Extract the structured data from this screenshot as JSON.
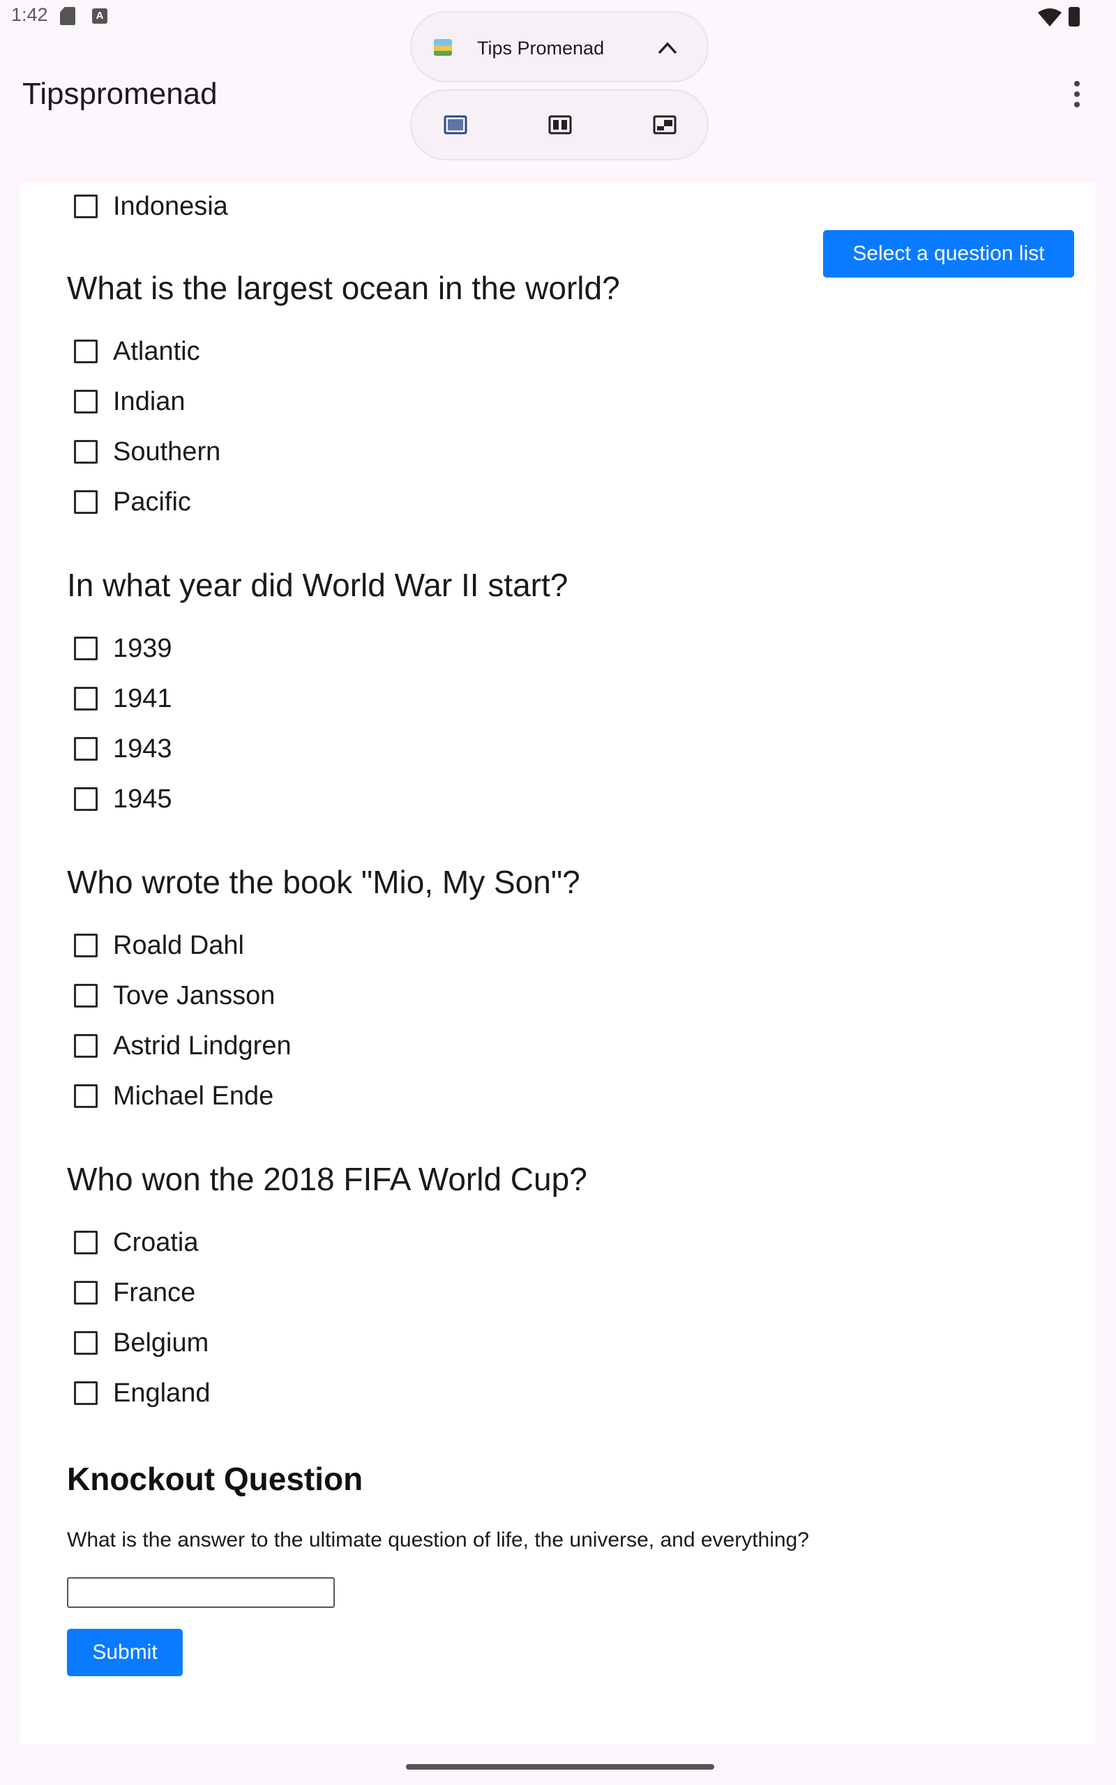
{
  "status_bar": {
    "time": "1:42",
    "a_glyph": "A"
  },
  "app": {
    "title": "Tipspromenad"
  },
  "window_handle": {
    "app_name": "Tips Promenad"
  },
  "actions": {
    "select_question_list": "Select a question list"
  },
  "partial_option": "Indonesia",
  "questions": [
    {
      "text": "What is the largest ocean in the world?",
      "options": [
        "Atlantic",
        "Indian",
        "Southern",
        "Pacific"
      ]
    },
    {
      "text": "In what year did World War II start?",
      "options": [
        "1939",
        "1941",
        "1943",
        "1945"
      ]
    },
    {
      "text": "Who wrote the book \"Mio, My Son\"?",
      "options": [
        "Roald Dahl",
        "Tove Jansson",
        "Astrid Lindgren",
        "Michael Ende"
      ]
    },
    {
      "text": "Who won the 2018 FIFA World Cup?",
      "options": [
        "Croatia",
        "France",
        "Belgium",
        "England"
      ]
    }
  ],
  "knockout": {
    "heading": "Knockout Question",
    "question": "What is the answer to the ultimate question of life, the universe, and everything?",
    "answer_value": "",
    "submit_label": "Submit"
  },
  "colors": {
    "accent": "#0a7bff",
    "background": "#fdf7fd"
  }
}
